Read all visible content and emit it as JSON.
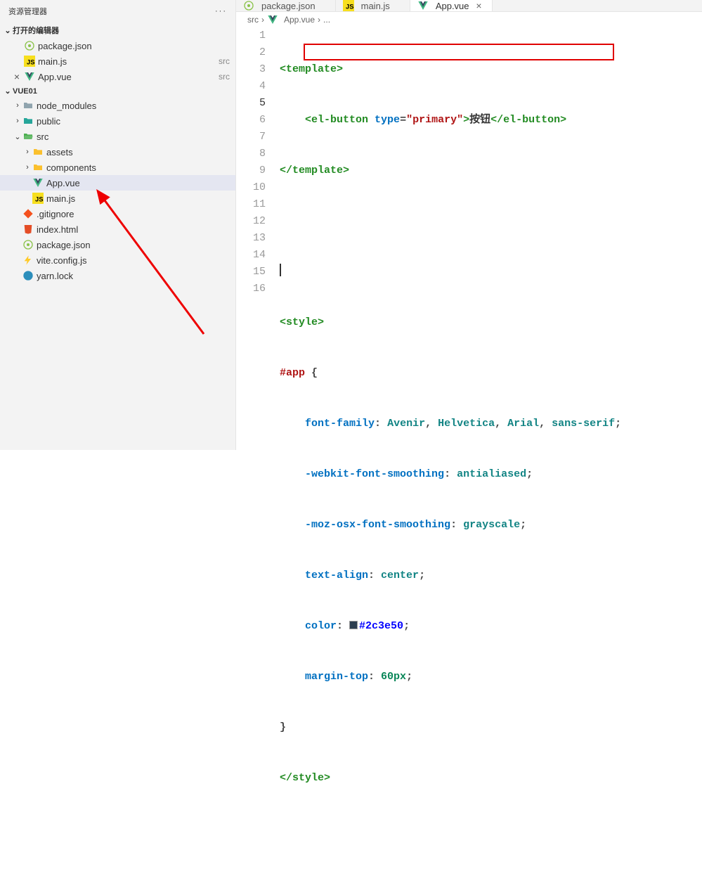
{
  "sidebar": {
    "title": "资源管理器",
    "openEditorsTitle": "打开的编辑器",
    "projectTitle": "VUE01",
    "openEditors": [
      {
        "name": "package.json",
        "desc": "",
        "icon": "npm"
      },
      {
        "name": "main.js",
        "desc": "src",
        "icon": "js"
      },
      {
        "name": "App.vue",
        "desc": "src",
        "icon": "vue",
        "close": true
      }
    ],
    "tree": [
      {
        "depth": 0,
        "chev": "›",
        "icon": "folder",
        "name": "node_modules"
      },
      {
        "depth": 0,
        "chev": "›",
        "icon": "folder-teal",
        "name": "public"
      },
      {
        "depth": 0,
        "chev": "⌄",
        "icon": "folder-open",
        "name": "src"
      },
      {
        "depth": 1,
        "chev": "›",
        "icon": "folder-yellow",
        "name": "assets"
      },
      {
        "depth": 1,
        "chev": "›",
        "icon": "folder-yellow",
        "name": "components"
      },
      {
        "depth": 1,
        "chev": "",
        "icon": "vue",
        "name": "App.vue",
        "selected": true
      },
      {
        "depth": 1,
        "chev": "",
        "icon": "js",
        "name": "main.js"
      },
      {
        "depth": 0,
        "chev": "",
        "icon": "git",
        "name": ".gitignore"
      },
      {
        "depth": 0,
        "chev": "",
        "icon": "html",
        "name": "index.html"
      },
      {
        "depth": 0,
        "chev": "",
        "icon": "npm",
        "name": "package.json"
      },
      {
        "depth": 0,
        "chev": "",
        "icon": "bolt",
        "name": "vite.config.js"
      },
      {
        "depth": 0,
        "chev": "",
        "icon": "yarn",
        "name": "yarn.lock"
      }
    ]
  },
  "tabs": [
    {
      "name": "package.json",
      "icon": "npm",
      "active": false
    },
    {
      "name": "main.js",
      "icon": "js",
      "active": false
    },
    {
      "name": "App.vue",
      "icon": "vue",
      "active": true,
      "close": true
    }
  ],
  "breadcrumb": {
    "segments": [
      "src",
      "App.vue",
      "..."
    ]
  },
  "code": {
    "lines": [
      1,
      2,
      3,
      4,
      5,
      6,
      7,
      8,
      9,
      10,
      11,
      12,
      13,
      14,
      15,
      16
    ],
    "currentLine": 5,
    "l1_tag_open": "<template>",
    "l2_a": "<el-button",
    "l2_b": "type",
    "l2_c": "=",
    "l2_d": "\"primary\"",
    "l2_e": ">",
    "l2_f": "按钮",
    "l2_g": "</el-button>",
    "l3": "</template>",
    "l6": "<style>",
    "l7a": "#app",
    "l7b": "{",
    "l8a": "font-family",
    "l8b": ": ",
    "l8c": "Avenir",
    "l8d": ", ",
    "l8e": "Helvetica",
    "l8f": ", ",
    "l8g": "Arial",
    "l8h": ", ",
    "l8i": "sans-serif",
    "l8j": ";",
    "l9a": "-webkit-font-smoothing",
    "l9b": "antialiased",
    "l10a": "-moz-osx-font-smoothing",
    "l10b": "grayscale",
    "l11a": "text-align",
    "l11b": "center",
    "l12a": "color",
    "l12b": "#2c3e50",
    "l13a": "margin-top",
    "l13b": "60px",
    "l14": "}",
    "l15": "</style>"
  },
  "icons": {
    "dots": "···",
    "chev_right": "›",
    "chev_down": "⌄",
    "close": "×",
    "crumb_sep": "›"
  }
}
